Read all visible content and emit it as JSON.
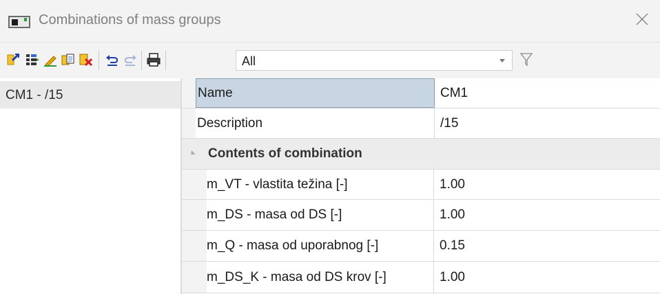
{
  "window": {
    "title": "Combinations of mass groups"
  },
  "toolbar": {
    "buttons": [
      "new-icon",
      "insert-icon",
      "edit-icon",
      "copy-icon",
      "delete-icon",
      "undo-icon",
      "redo-icon",
      "print-icon"
    ],
    "filter": {
      "selected": "All"
    }
  },
  "list": {
    "items": [
      "CM1 - /15"
    ]
  },
  "properties": {
    "name": {
      "label": "Name",
      "value": "CM1"
    },
    "description": {
      "label": "Description",
      "value": "/15"
    },
    "section": {
      "label": "Contents of combination"
    },
    "rows": [
      {
        "label": "m_VT - vlastita težina [-]",
        "value": "1.00"
      },
      {
        "label": "m_DS - masa od DS [-]",
        "value": "1.00"
      },
      {
        "label": "m_Q - masa od uporabnog [-]",
        "value": "0.15"
      },
      {
        "label": "m_DS_K - masa od DS krov [-]",
        "value": "1.00"
      }
    ]
  },
  "colors": {
    "selection": "#c8d6e4",
    "section_bg": "#ececec",
    "chrome": "#f3f3f3"
  }
}
